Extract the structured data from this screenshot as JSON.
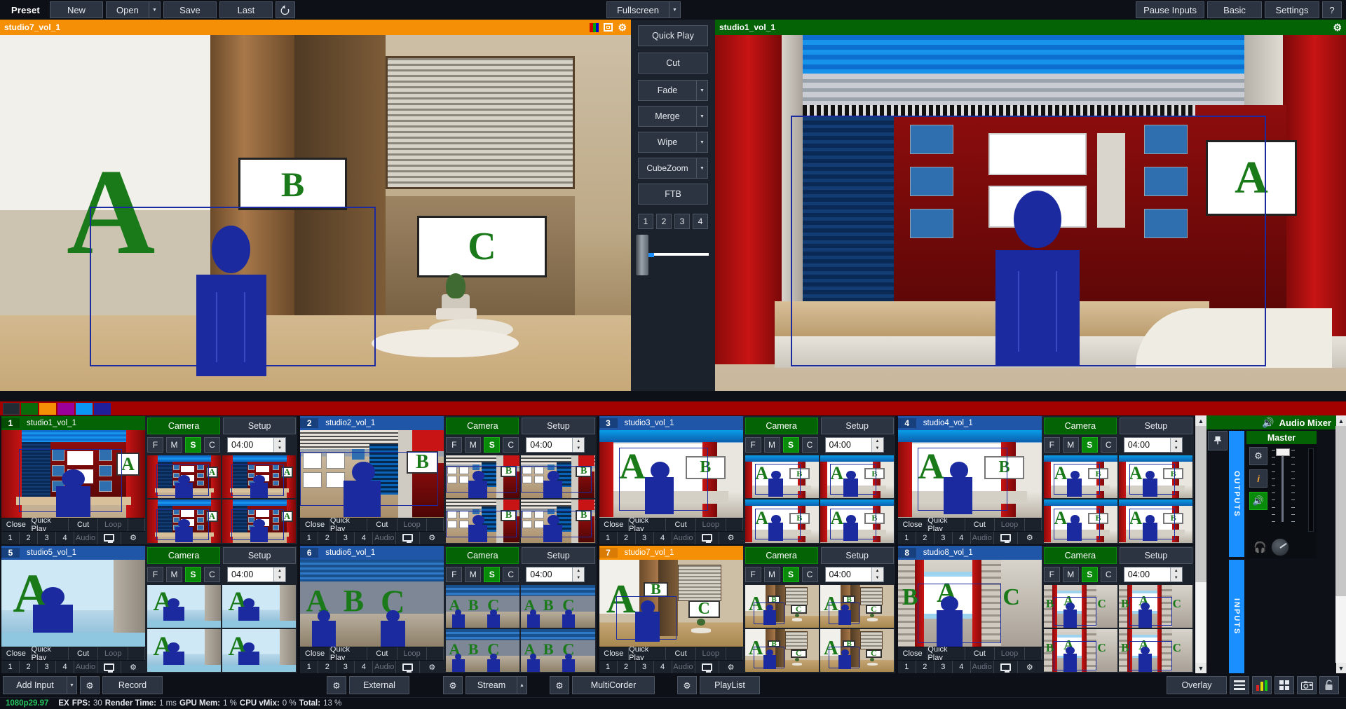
{
  "toolbar": {
    "preset_label": "Preset",
    "new_label": "New",
    "open_label": "Open",
    "save_label": "Save",
    "last_label": "Last",
    "undo_icon": "undo-icon",
    "fullscreen_label": "Fullscreen",
    "pause_inputs_label": "Pause Inputs",
    "basic_label": "Basic",
    "settings_label": "Settings",
    "help_label": "?"
  },
  "preview": {
    "title": "studio7_vol_1",
    "header_color": "#f59006",
    "icons": [
      "color-bars-icon",
      "window-icon",
      "gear-icon"
    ]
  },
  "program": {
    "title": "studio1_vol_1",
    "header_color": "#046304",
    "icons": [
      "gear-icon"
    ]
  },
  "transitions": {
    "quick_play": "Quick Play",
    "cut": "Cut",
    "buttons": [
      {
        "label": "Fade",
        "has_arrow": true
      },
      {
        "label": "Merge",
        "has_arrow": true
      },
      {
        "label": "Wipe",
        "has_arrow": true
      },
      {
        "label": "CubeZoom",
        "has_arrow": true
      }
    ],
    "ftb": "FTB",
    "numbers": [
      "1",
      "2",
      "3",
      "4"
    ],
    "fader_position_pct": 14,
    "fader_color": "#1a8fff"
  },
  "tag_colors": [
    "#a30000",
    "#0a6b0a",
    "#f59006",
    "#9b009b",
    "#0a96f5",
    "#1f1f9b"
  ],
  "inputs": [
    {
      "number": "1",
      "name": "studio1_vol_1",
      "header": "green",
      "camera": "Camera",
      "setup": "Setup",
      "keys": [
        "F",
        "M",
        "S",
        "C"
      ],
      "active_key": "S",
      "duration": "04:00",
      "actions": [
        "Close",
        "Quick Play",
        "Cut",
        "Loop"
      ],
      "row2": [
        "1",
        "2",
        "3",
        "4"
      ],
      "audio_label": "Audio"
    },
    {
      "number": "2",
      "name": "studio2_vol_1",
      "header": "blue",
      "camera": "Camera",
      "setup": "Setup",
      "keys": [
        "F",
        "M",
        "S",
        "C"
      ],
      "active_key": "S",
      "duration": "04:00",
      "actions": [
        "Close",
        "Quick Play",
        "Cut",
        "Loop"
      ],
      "row2": [
        "1",
        "2",
        "3",
        "4"
      ],
      "audio_label": "Audio"
    },
    {
      "number": "3",
      "name": "studio3_vol_1",
      "header": "blue",
      "camera": "Camera",
      "setup": "Setup",
      "keys": [
        "F",
        "M",
        "S",
        "C"
      ],
      "active_key": "S",
      "duration": "04:00",
      "actions": [
        "Close",
        "Quick Play",
        "Cut",
        "Loop"
      ],
      "row2": [
        "1",
        "2",
        "3",
        "4"
      ],
      "audio_label": "Audio"
    },
    {
      "number": "4",
      "name": "studio4_vol_1",
      "header": "blue",
      "camera": "Camera",
      "setup": "Setup",
      "keys": [
        "F",
        "M",
        "S",
        "C"
      ],
      "active_key": "S",
      "duration": "04:00",
      "actions": [
        "Close",
        "Quick Play",
        "Cut",
        "Loop"
      ],
      "row2": [
        "1",
        "2",
        "3",
        "4"
      ],
      "audio_label": "Audio"
    },
    {
      "number": "5",
      "name": "studio5_vol_1",
      "header": "blue",
      "camera": "Camera",
      "setup": "Setup",
      "keys": [
        "F",
        "M",
        "S",
        "C"
      ],
      "active_key": "S",
      "duration": "04:00",
      "actions": [
        "Close",
        "Quick Play",
        "Cut",
        "Loop"
      ],
      "row2": [
        "1",
        "2",
        "3",
        "4"
      ],
      "audio_label": "Audio"
    },
    {
      "number": "6",
      "name": "studio6_vol_1",
      "header": "blue",
      "camera": "Camera",
      "setup": "Setup",
      "keys": [
        "F",
        "M",
        "S",
        "C"
      ],
      "active_key": "S",
      "duration": "04:00",
      "actions": [
        "Close",
        "Quick Play",
        "Cut",
        "Loop"
      ],
      "row2": [
        "1",
        "2",
        "3",
        "4"
      ],
      "audio_label": "Audio"
    },
    {
      "number": "7",
      "name": "studio7_vol_1",
      "header": "orange",
      "camera": "Camera",
      "setup": "Setup",
      "keys": [
        "F",
        "M",
        "S",
        "C"
      ],
      "active_key": "S",
      "duration": "04:00",
      "actions": [
        "Close",
        "Quick Play",
        "Cut",
        "Loop"
      ],
      "row2": [
        "1",
        "2",
        "3",
        "4"
      ],
      "audio_label": "Audio"
    },
    {
      "number": "8",
      "name": "studio8_vol_1",
      "header": "blue",
      "camera": "Camera",
      "setup": "Setup",
      "keys": [
        "F",
        "M",
        "S",
        "C"
      ],
      "active_key": "S",
      "duration": "04:00",
      "actions": [
        "Close",
        "Quick Play",
        "Cut",
        "Loop"
      ],
      "row2": [
        "1",
        "2",
        "3",
        "4"
      ],
      "audio_label": "Audio"
    }
  ],
  "audio_mixer": {
    "title": "Audio Mixer",
    "speaker_icon": "speaker-icon",
    "pin_icon": "pin-icon",
    "tabs": [
      "OUTPUTS",
      "INPUTS"
    ],
    "master": {
      "label": "Master",
      "gear_icon": "gear-icon",
      "info_label": "i",
      "mute_icon": "speaker-icon",
      "mute_active": true,
      "headphone_icon": "headphones-icon",
      "knob_icon": "volume-knob"
    }
  },
  "bottom_toolbar": {
    "add_input": "Add Input",
    "record": "Record",
    "external": "External",
    "stream": "Stream",
    "multicorder": "MultiCorder",
    "playlist": "PlayList",
    "overlay": "Overlay",
    "icons": [
      "gear-icon",
      "hamburger-icon",
      "audio-levels-icon",
      "grid-icon",
      "camera-icon",
      "lock-icon"
    ]
  },
  "status_bar": {
    "resolution": "1080p29.97",
    "ex": "EX",
    "fps_label": "FPS:",
    "fps_value": "30",
    "render_label": "Render Time:",
    "render_value": "1 ms",
    "gpu_label": "GPU Mem:",
    "gpu_value": "1 %",
    "cpu_label": "CPU vMix:",
    "cpu_value": "0 %",
    "total_label": "Total:",
    "total_value": "13 %"
  }
}
